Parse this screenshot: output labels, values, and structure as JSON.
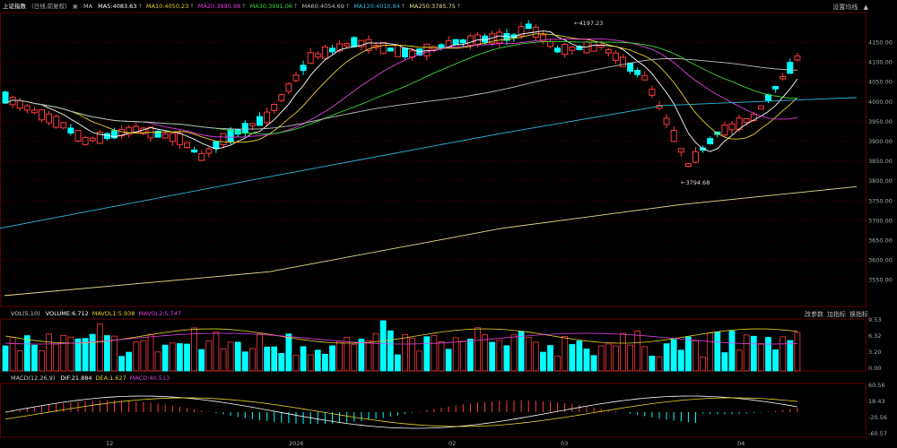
{
  "main_header": {
    "index_name": "上证指数",
    "period": "(日线,前复权)",
    "ma_label": "MA",
    "ma_values": [
      {
        "text": "MA5:4083.63",
        "color": "#ffffff"
      },
      {
        "text": "MA10:4050.23",
        "color": "#e8d32a"
      },
      {
        "text": "MA20:3995.98",
        "color": "#e040e0"
      },
      {
        "text": "MA30:3991.06",
        "color": "#3ad83a"
      },
      {
        "text": "MA60:4054.69",
        "color": "#bdbdbd"
      },
      {
        "text": "MA120:4010.84",
        "color": "#2cb8d8"
      },
      {
        "text": "MA250:3785.75",
        "color": "#e8e08a"
      }
    ],
    "settings_label": "设置均线"
  },
  "price_axis": [
    "4150.00",
    "4100.00",
    "4050.00",
    "4000.00",
    "3950.00",
    "3900.00",
    "3850.00",
    "3800.00",
    "3750.00",
    "3700.00",
    "3650.00",
    "3600.00",
    "3550.00"
  ],
  "annotations": {
    "high": "4197.23",
    "low": "3794.68"
  },
  "volume_header": {
    "name": "VOL(5,10)",
    "values": [
      {
        "text": "VOLUME:6.712",
        "color": "#ffffff"
      },
      {
        "text": "MAVOL1:5.938",
        "color": "#e8d32a"
      },
      {
        "text": "MAVOL2:5.747",
        "color": "#e040e0"
      }
    ],
    "buttons": [
      "改参数",
      "加指标",
      "换指标"
    ]
  },
  "volume_axis": [
    "9.53",
    "6.32",
    "3.20",
    "0.00"
  ],
  "macd_header": {
    "name": "MACD(12,26,9)",
    "values": [
      {
        "text": "DIF:21.884",
        "color": "#ffffff"
      },
      {
        "text": "DEA:1.627",
        "color": "#e8d32a"
      },
      {
        "text": "MACD:40.513",
        "color": "#e040e0"
      }
    ],
    "buttons": [
      "改参数",
      "加指标",
      "换指标"
    ]
  },
  "macd_axis": [
    "60.56",
    "18.43",
    "-20.56",
    "-60.57"
  ],
  "time_axis": [
    "12",
    "2026",
    "02",
    "03",
    "04"
  ],
  "colors": {
    "up": "#ff3b3b",
    "down": "#00ffff",
    "grid": "#5a0000",
    "ma5": "#ffffff",
    "ma10": "#e8d32a",
    "ma20": "#e040e0",
    "ma30": "#3ad83a",
    "ma60": "#bdbdbd",
    "ma120": "#2cb8d8",
    "ma250": "#e8e08a"
  }
}
